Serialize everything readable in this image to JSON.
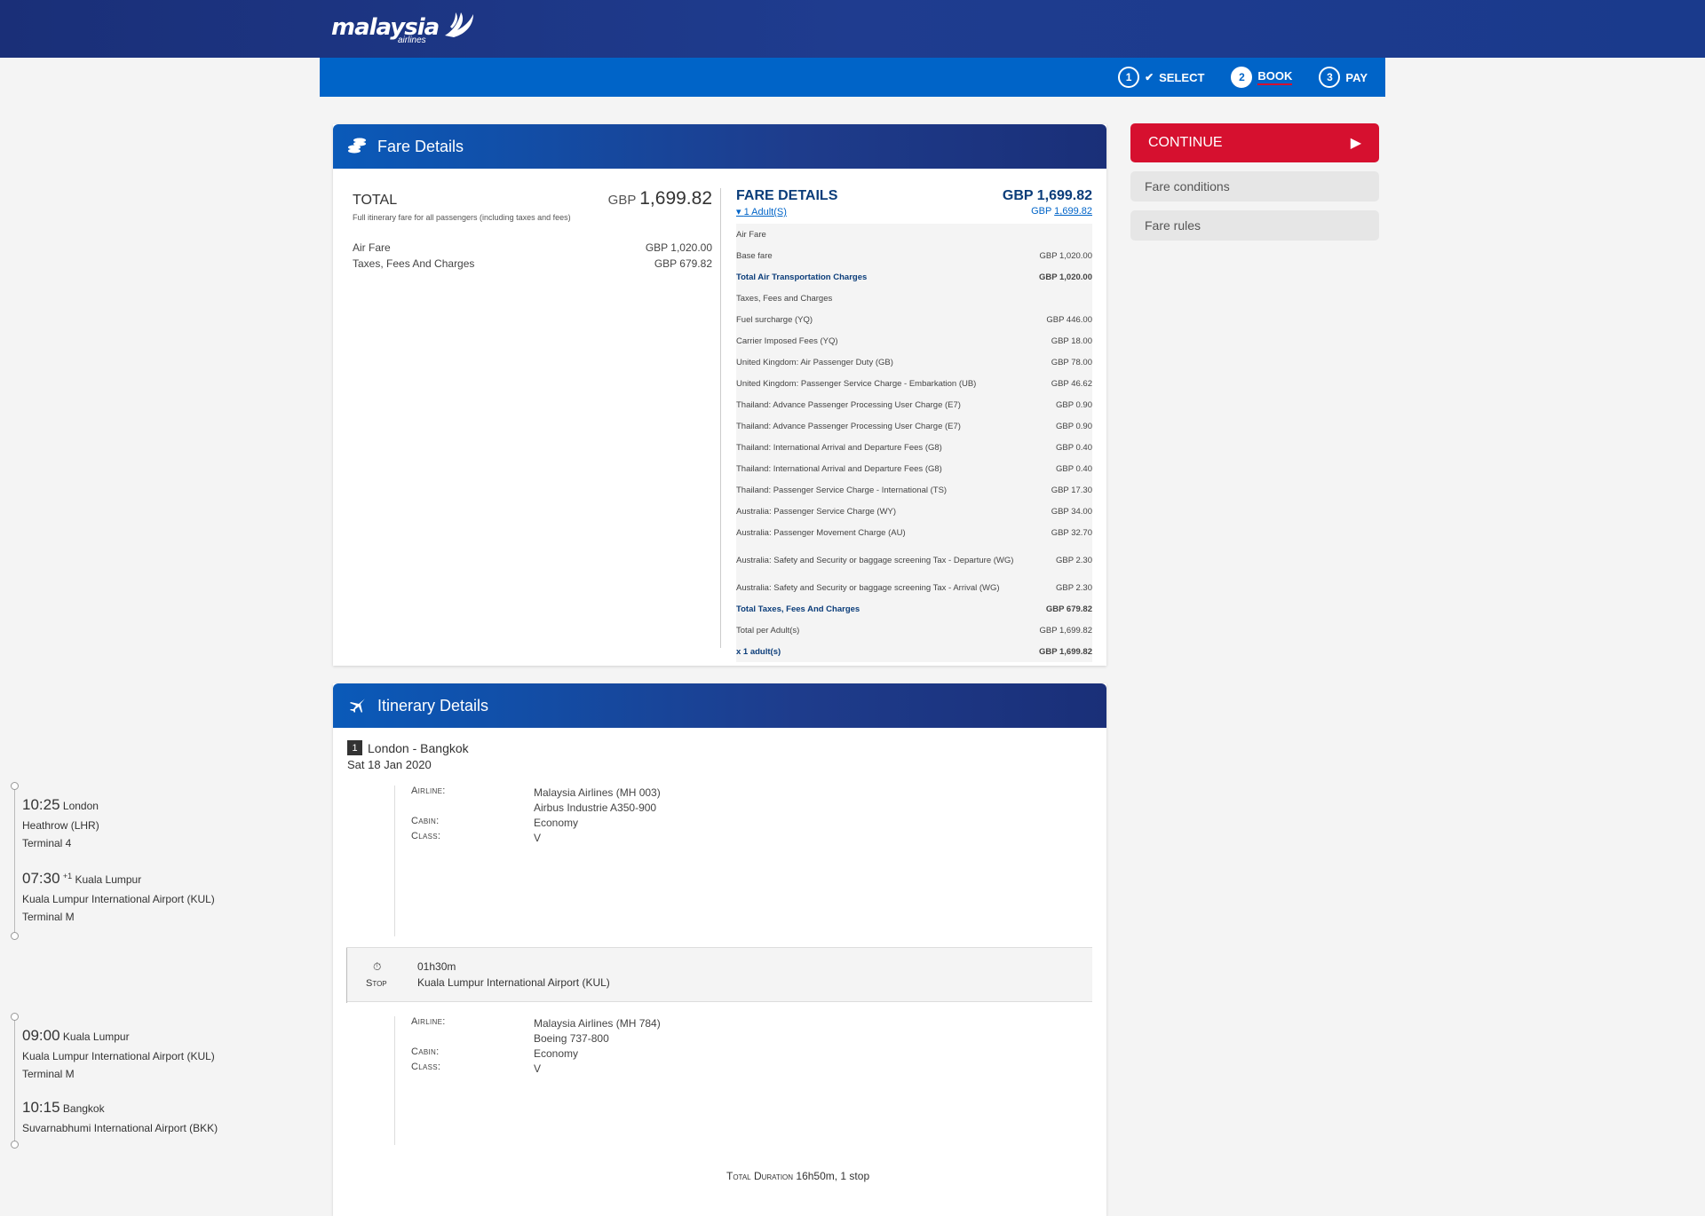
{
  "header": {
    "logo_text": "malaysia",
    "logo_sub": "airlines",
    "steps": [
      {
        "num": "1",
        "label": "SELECT"
      },
      {
        "num": "2",
        "label": "BOOK"
      },
      {
        "num": "3",
        "label": "PAY"
      }
    ]
  },
  "sidebar": {
    "continue_label": "CONTINUE",
    "fare_conditions": "Fare conditions",
    "fare_rules": "Fare rules"
  },
  "fare": {
    "panel_title": "Fare Details",
    "total_label": "TOTAL",
    "total_currency": "GBP",
    "total_amount": "1,699.82",
    "total_note": "Full itinerary fare for all passengers (including taxes and fees)",
    "lines": [
      {
        "label": "Air Fare",
        "value": "GBP 1,020.00"
      },
      {
        "label": "Taxes, Fees And Charges",
        "value": "GBP 679.82"
      }
    ],
    "details": {
      "title": "FARE DETAILS",
      "adults_link": "1 Adult(S)",
      "total": "GBP 1,699.82",
      "total_sub_currency": "GBP",
      "total_sub_amount": "1,699.82",
      "rows": [
        {
          "label": "Air Fare",
          "value": ""
        },
        {
          "label": "Base fare",
          "value": "GBP 1,020.00"
        },
        {
          "label": "Total Air Transportation Charges",
          "value": "GBP 1,020.00"
        },
        {
          "label": "Taxes, Fees and Charges",
          "value": ""
        },
        {
          "label": "Fuel surcharge (YQ)",
          "value": "GBP 446.00"
        },
        {
          "label": "Carrier Imposed Fees (YQ)",
          "value": "GBP 18.00"
        },
        {
          "label": "United Kingdom: Air Passenger Duty (GB)",
          "value": "GBP 78.00"
        },
        {
          "label": "United Kingdom: Passenger Service Charge - Embarkation (UB)",
          "value": "GBP 46.62"
        },
        {
          "label": "Thailand: Advance Passenger Processing User Charge (E7)",
          "value": "GBP 0.90"
        },
        {
          "label": "Thailand: Advance Passenger Processing User Charge (E7)",
          "value": "GBP 0.90"
        },
        {
          "label": "Thailand: International Arrival and Departure Fees (G8)",
          "value": "GBP 0.40"
        },
        {
          "label": "Thailand: International Arrival and Departure Fees (G8)",
          "value": "GBP 0.40"
        },
        {
          "label": "Thailand: Passenger Service Charge - International (TS)",
          "value": "GBP 17.30"
        },
        {
          "label": "Australia: Passenger Service Charge (WY)",
          "value": "GBP 34.00"
        },
        {
          "label": "Australia: Passenger Movement Charge (AU)",
          "value": "GBP 32.70"
        },
        {
          "label": "Australia: Safety and Security or baggage screening Tax - Departure (WG)",
          "value": "GBP 2.30"
        },
        {
          "label": "Australia: Safety and Security or baggage screening Tax - Arrival (WG)",
          "value": "GBP 2.30"
        },
        {
          "label": "Total Taxes, Fees And Charges",
          "value": "GBP 679.82"
        },
        {
          "label": "Total per Adult(s)",
          "value": "GBP 1,699.82"
        },
        {
          "label": "x 1 adult(s)",
          "value": "GBP 1,699.82"
        }
      ]
    }
  },
  "itinerary": {
    "panel_title": "Itinerary Details",
    "route_num": "1",
    "route": "London - Bangkok",
    "date": "Sat 18 Jan 2020",
    "segments": [
      {
        "dep_time": "10:25",
        "dep_city": "London",
        "dep_airport": "Heathrow (LHR)",
        "dep_terminal": "Terminal 4",
        "arr_time": "07:30",
        "arr_offset": "+1",
        "arr_city": "Kuala Lumpur",
        "arr_airport": "Kuala Lumpur International Airport (KUL)",
        "arr_terminal": "Terminal M",
        "airline_label": "Airline:",
        "airline": "Malaysia Airlines (MH 003)",
        "aircraft": "Airbus Industrie A350-900",
        "cabin_label": "Cabin:",
        "cabin": "Economy",
        "class_label": "Class:",
        "class": "V"
      },
      {
        "dep_time": "09:00",
        "dep_city": "Kuala Lumpur",
        "dep_airport": "Kuala Lumpur International Airport (KUL)",
        "dep_terminal": "Terminal M",
        "arr_time": "10:15",
        "arr_city": "Bangkok",
        "arr_airport": "Suvarnabhumi International Airport (BKK)",
        "airline_label": "Airline:",
        "airline": "Malaysia Airlines (MH 784)",
        "aircraft": "Boeing 737-800",
        "cabin_label": "Cabin:",
        "cabin": "Economy",
        "class_label": "Class:",
        "class": "V"
      }
    ],
    "stop": {
      "label": "Stop",
      "duration": "01h30m",
      "airport": "Kuala Lumpur International Airport (KUL)"
    },
    "total_duration_label": "Total Duration",
    "total_duration": "16h50m, 1 stop"
  }
}
